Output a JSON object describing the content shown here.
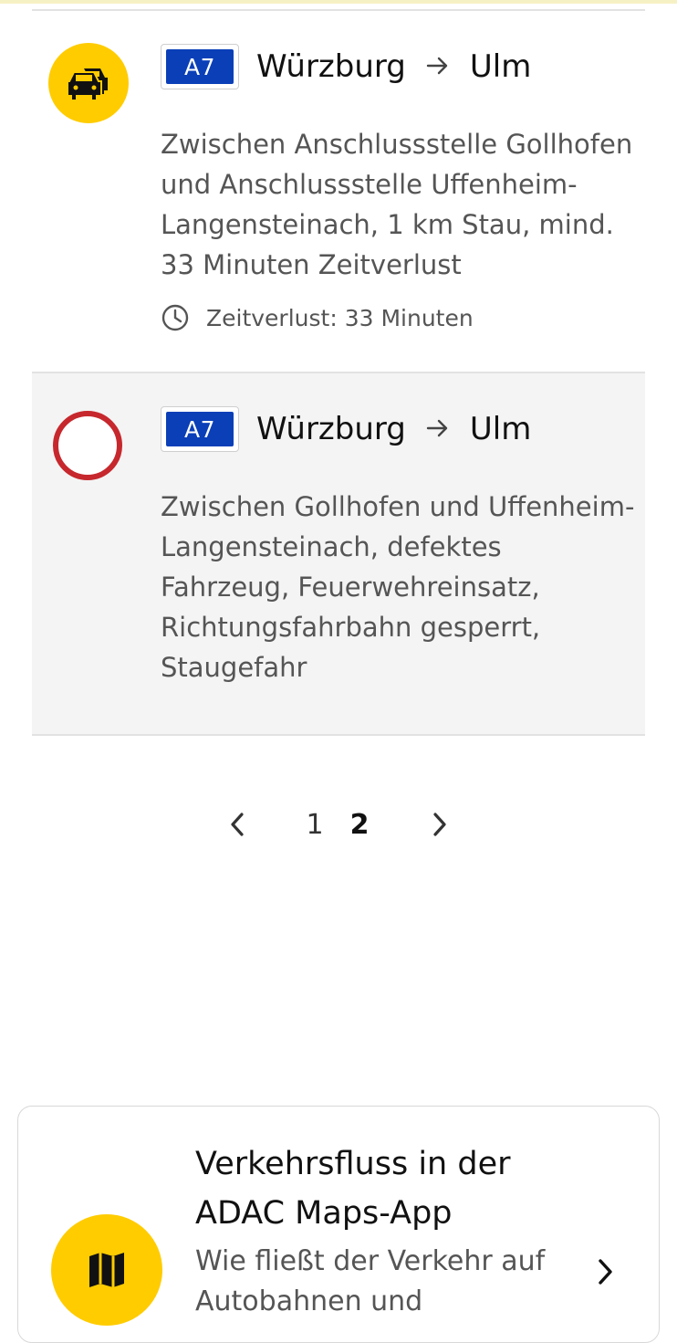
{
  "incidents": [
    {
      "type": "traffic-jam",
      "road": "A7",
      "from": "Würzburg",
      "to": "Ulm",
      "description": "Zwischen Anschlussstelle Gollhofen und Anschlussstelle Uffenheim-Langensteinach, 1 km Stau, mind. 33 Minuten Zeitverlust",
      "delay_label": "Zeitverlust: 33 Minuten",
      "icon": "traffic-jam-icon"
    },
    {
      "type": "road-closure",
      "road": "A7",
      "from": "Würzburg",
      "to": "Ulm",
      "description": "Zwischen Gollhofen und Uffenheim-Langensteinach, defektes Fahrzeug, Feuerwehreinsatz, Richtungsfahrbahn gesperrt, Staugefahr",
      "icon": "road-closed-sign-icon"
    }
  ],
  "pagination": {
    "pages": [
      "1",
      "2"
    ],
    "current": "2"
  },
  "promo": {
    "title": "Verkehrsfluss in der ADAC Maps-App",
    "text": "Wie fließt der Verkehr auf Autobahnen und",
    "icon": "map-icon"
  },
  "colors": {
    "accent_yellow": "#ffcc00",
    "autobahn_blue": "#0a3fb8",
    "closure_red": "#c6282d",
    "highlight_bg": "#f4f4f4"
  }
}
